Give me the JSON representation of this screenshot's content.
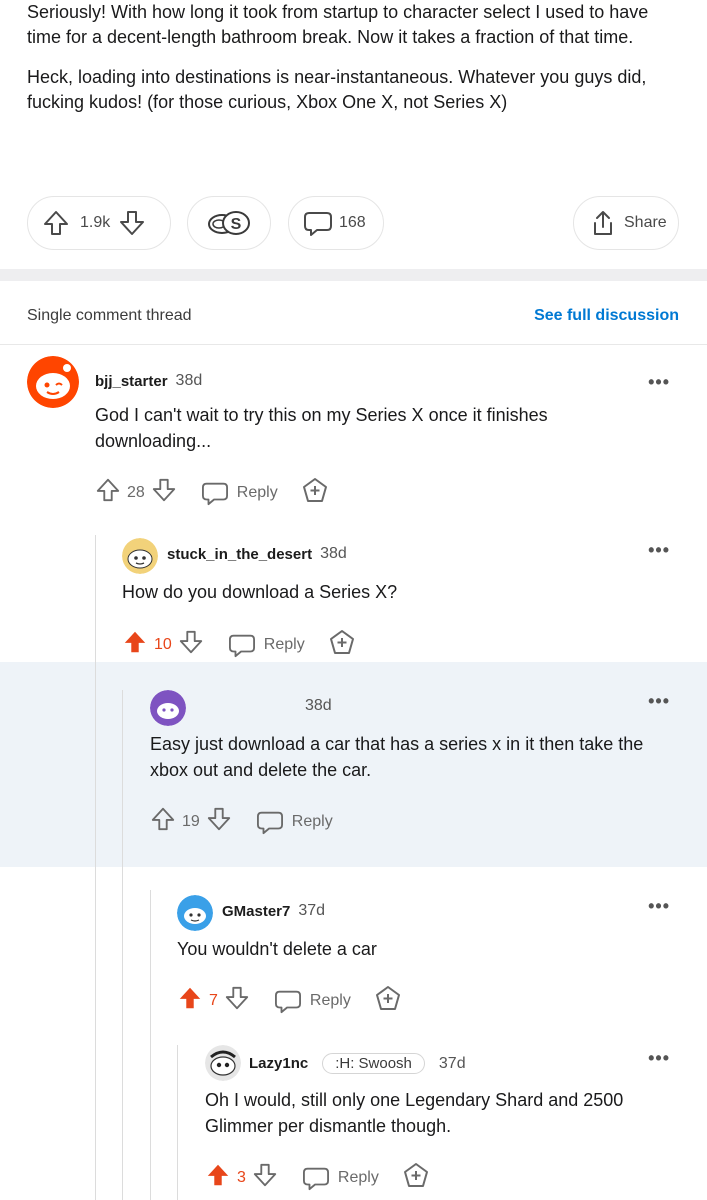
{
  "post": {
    "paragraphs": [
      "Seriously! With how long it took from startup to character select I used to have time for a decent-length bathroom break. Now it takes a fraction of that time.",
      "Heck, loading into destinations is near-instantaneous. Whatever you guys did, fucking kudos! (for those curious, Xbox One X, not Series X)"
    ],
    "votes": "1.9k",
    "comments": "168",
    "share_label": "Share"
  },
  "thread": {
    "title": "Single comment thread",
    "see_full": "See full discussion"
  },
  "comments": [
    {
      "user": "bjj_starter",
      "age": "38d",
      "text": "God I can't wait to try this on my Series X once it finishes downloading...",
      "score": "28",
      "upvoted": false,
      "reply_label": "Reply",
      "more": "•••"
    },
    {
      "user": "stuck_in_the_desert",
      "age": "38d",
      "text": "How do you download a Series X?",
      "score": "10",
      "upvoted": true,
      "reply_label": "Reply",
      "more": "•••"
    },
    {
      "user": "",
      "age": "38d",
      "text": "Easy just download a car that has a series x in it then take the xbox out and delete the car.",
      "score": "19",
      "upvoted": false,
      "reply_label": "Reply",
      "more": "•••"
    },
    {
      "user": "GMaster7",
      "age": "37d",
      "text": "You wouldn't delete a car",
      "score": "7",
      "upvoted": true,
      "reply_label": "Reply",
      "more": "•••"
    },
    {
      "user": "Lazy1nc",
      "flair": ":H: Swoosh",
      "age": "37d",
      "text": "Oh I would, still only one Legendary Shard and 2500 Glimmer per dismantle though.",
      "score": "3",
      "upvoted": true,
      "reply_label": "Reply",
      "more": "•••"
    }
  ],
  "colors": {
    "upvote_active": "#e8461a",
    "link": "#0079d3",
    "highlight_bg": "#eef3f8"
  }
}
